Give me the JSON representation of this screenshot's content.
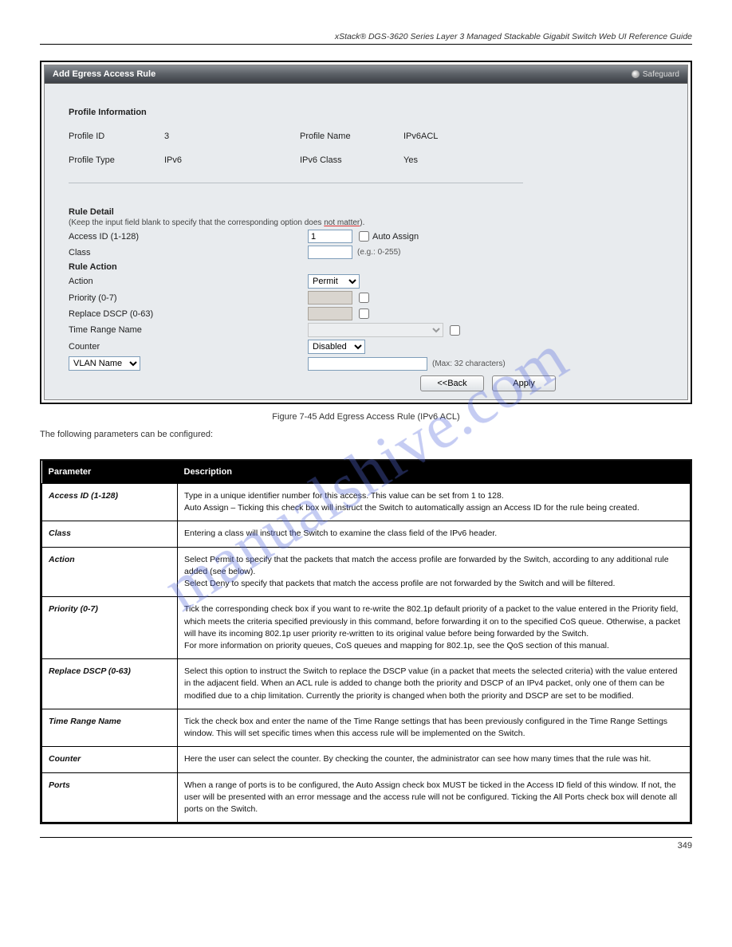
{
  "watermark": "manualshive.com",
  "header_line": "xStack® DGS-3620 Series Layer 3 Managed Stackable Gigabit Switch Web UI Reference Guide",
  "titlebar": {
    "title": "Add Egress Access Rule",
    "safeguard": "Safeguard"
  },
  "profile_info": {
    "heading": "Profile Information",
    "profile_id_label": "Profile ID",
    "profile_id_value": "3",
    "profile_name_label": "Profile Name",
    "profile_name_value": "IPv6ACL",
    "profile_type_label": "Profile Type",
    "profile_type_value": "IPv6",
    "ipv6_class_label": "IPv6 Class",
    "ipv6_class_value": "Yes"
  },
  "rule_detail": {
    "heading": "Rule Detail",
    "subtext_pre": "(Keep the input field blank to specify that the corresponding option does ",
    "subtext_marked": "not matter",
    "subtext_post": ").",
    "access_id_label": "Access ID (1-128)",
    "access_id_value": "1",
    "auto_assign_label": "Auto Assign",
    "class_label": "Class",
    "class_hint": "(e.g.: 0-255)"
  },
  "rule_action": {
    "heading": "Rule Action",
    "action_label": "Action",
    "action_value": "Permit",
    "priority_label": "Priority (0-7)",
    "replace_dscp_label": "Replace DSCP (0-63)",
    "time_range_label": "Time Range Name",
    "counter_label": "Counter",
    "counter_value": "Disabled",
    "vlan_name_option": "VLAN Name",
    "vlan_hint": "(Max: 32 characters)"
  },
  "buttons": {
    "back": "<<Back",
    "apply": "Apply"
  },
  "figure_caption": "Figure 7-45 Add Egress Access Rule (IPv6 ACL)",
  "intro_text": "The following parameters can be configured:",
  "param_header": {
    "col1": "Parameter",
    "col2": "Description"
  },
  "params": [
    {
      "name": "Access ID (1-128)",
      "desc": "Type in a unique identifier number for this access. This value can be set from 1 to 128.\nAuto Assign – Ticking this check box will instruct the Switch to automatically assign an Access ID for the rule being created."
    },
    {
      "name": "Class",
      "desc": "Entering a class will instruct the Switch to examine the class field of the IPv6 header."
    },
    {
      "name": "Action",
      "desc": "Select Permit to specify that the packets that match the access profile are forwarded by the Switch, according to any additional rule added (see below).\nSelect Deny to specify that packets that match the access profile are not forwarded by the Switch and will be filtered."
    },
    {
      "name": "Priority (0-7)",
      "desc": "Tick the corresponding check box if you want to re-write the 802.1p default priority of a packet to the value entered in the Priority field, which meets the criteria specified previously in this command, before forwarding it on to the specified CoS queue. Otherwise, a packet will have its incoming 802.1p user priority re-written to its original value before being forwarded by the Switch.\nFor more information on priority queues, CoS queues and mapping for 802.1p, see the QoS section of this manual."
    },
    {
      "name": "Replace DSCP (0-63)",
      "desc": "Select this option to instruct the Switch to replace the DSCP value (in a packet that meets the selected criteria) with the value entered in the adjacent field. When an ACL rule is added to change both the priority and DSCP of an IPv4 packet, only one of them can be modified due to a chip limitation. Currently the priority is changed when both the priority and DSCP are set to be modified."
    },
    {
      "name": "Time Range Name",
      "desc": "Tick the check box and enter the name of the Time Range settings that has been previously configured in the Time Range Settings window. This will set specific times when this access rule will be implemented on the Switch."
    },
    {
      "name": "Counter",
      "desc": "Here the user can select the counter. By checking the counter, the administrator can see how many times that the rule was hit."
    },
    {
      "name": "Ports",
      "desc": "When a range of ports is to be configured, the Auto Assign check box MUST be ticked in the Access ID field of this window. If not, the user will be presented with an error message and the access rule will not be configured. Ticking the All Ports check box will denote all ports on the Switch."
    }
  ],
  "page_number": "349"
}
